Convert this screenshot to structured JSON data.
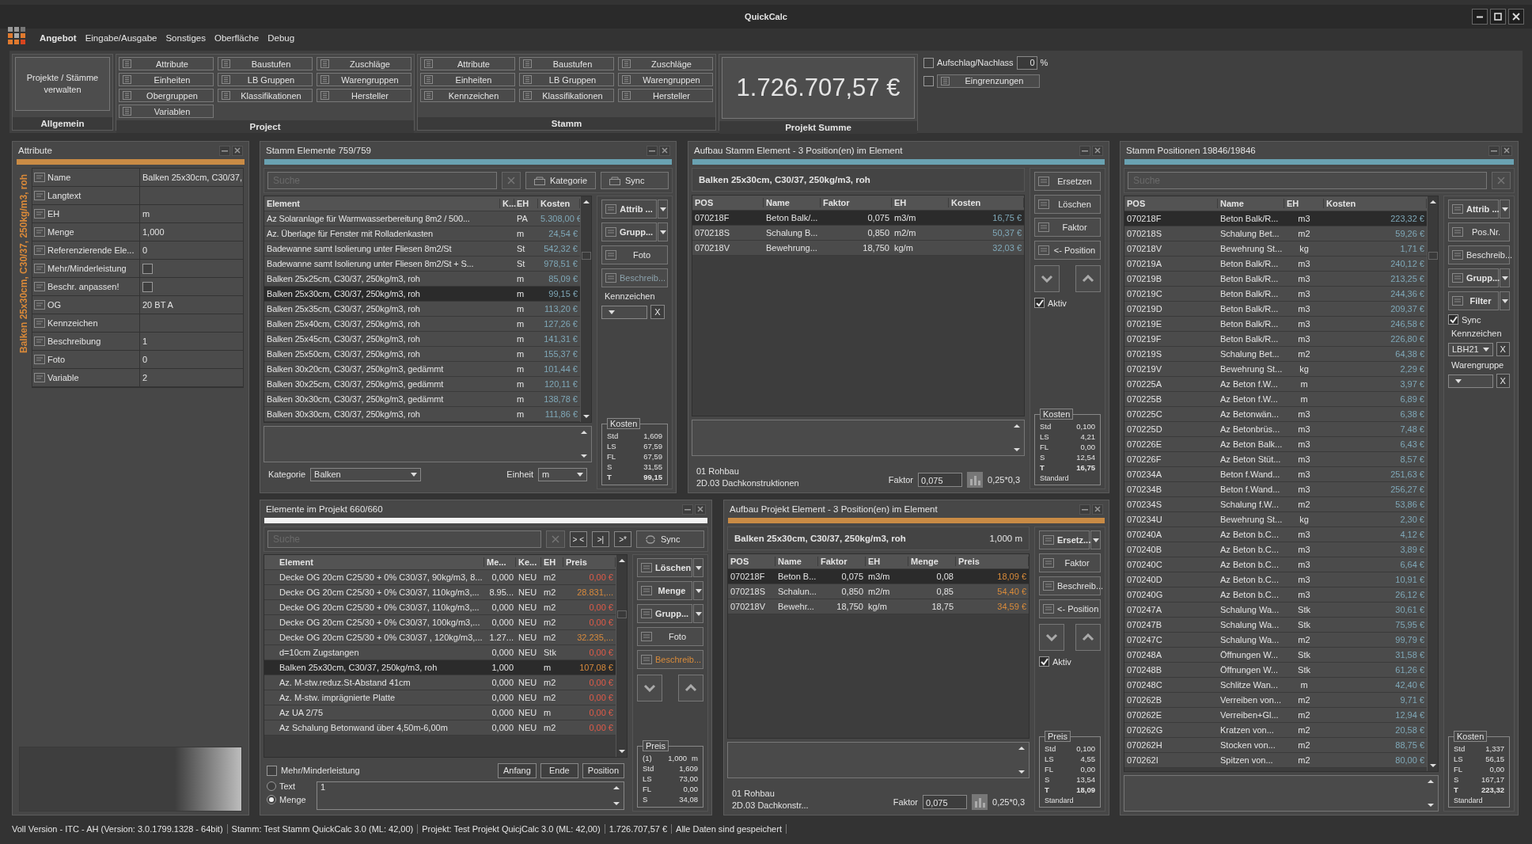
{
  "window": {
    "title": "QuickCalc"
  },
  "menu": [
    {
      "label": "Angebot",
      "selected": true
    },
    {
      "label": "Eingabe/Ausgabe",
      "selected": false
    },
    {
      "label": "Sonstiges",
      "selected": false
    },
    {
      "label": "Oberfläche",
      "selected": false
    },
    {
      "label": "Debug",
      "selected": false
    }
  ],
  "ribbon": {
    "allgemein": {
      "title": "Allgemein",
      "button": "Projekte / Stämme verwalten"
    },
    "project": {
      "title": "Project",
      "buttons": [
        "Attribute",
        "Baustufen",
        "Zuschläge",
        "Einheiten",
        "LB Gruppen",
        "Warengruppen",
        "Obergruppen",
        "Klassifikationen",
        "Hersteller",
        "Variablen"
      ]
    },
    "stamm": {
      "title": "Stamm",
      "buttons": [
        "Attribute",
        "Baustufen",
        "Zuschläge",
        "Einheiten",
        "LB Gruppen",
        "Warengruppen",
        "Kennzeichen",
        "Klassifikationen",
        "Hersteller"
      ]
    },
    "summe": {
      "title": "Projekt Summe",
      "value": "1.726.707,57 €"
    },
    "aufschlag": {
      "label": "Aufschlag/Nachlass",
      "checked": false,
      "value": "0",
      "unit": "%"
    },
    "eingrenzungen": {
      "label": "Eingrenzungen",
      "checked": false
    }
  },
  "attribute": {
    "title": "Attribute",
    "caption": "Balken 25x30cm, C30/37, 250kg/m3,  roh",
    "rows": [
      {
        "kind": "text",
        "label": "Name",
        "value": "Balken 25x30cm, C30/37,"
      },
      {
        "kind": "text",
        "label": "Langtext"
      },
      {
        "kind": "text",
        "label": "EH",
        "value": "m"
      },
      {
        "kind": "text",
        "label": "Menge",
        "value": "1,000"
      },
      {
        "kind": "text",
        "label": "Referenzierende Ele...",
        "value": "0"
      },
      {
        "kind": "check",
        "label": "Mehr/Minderleistung",
        "checked": false
      },
      {
        "kind": "check",
        "label": "Beschr. anpassen!",
        "checked": false
      },
      {
        "kind": "text",
        "label": "OG",
        "value": "20 BT A"
      },
      {
        "kind": "text",
        "label": "Kennzeichen"
      },
      {
        "kind": "text",
        "label": "Beschreibung",
        "value": "1"
      },
      {
        "kind": "text",
        "label": "Foto",
        "value": "0"
      },
      {
        "kind": "text",
        "label": "Variable",
        "value": "2"
      }
    ]
  },
  "stamm_elemente": {
    "title": "Stamm Elemente 759/759",
    "search": {
      "placeholder": "Suche"
    },
    "buttons": [
      "Kategorie",
      "Sync"
    ],
    "columns": [
      "Element",
      "K...",
      "EH",
      "Kosten"
    ],
    "rows": [
      {
        "element": "Az Solaranlage für Warmwasserbereitung 8m2 / 500...",
        "eh": "PA",
        "kosten": "5.308,00 €",
        "selected": false
      },
      {
        "element": "Az. Überlage für Fenster mit Rolladenkasten",
        "eh": "m",
        "kosten": "24,54 €",
        "selected": false
      },
      {
        "element": "Badewanne samt Isolierung unter Fliesen 8m2/St",
        "eh": "St",
        "kosten": "542,32 €",
        "selected": false
      },
      {
        "element": "Badewanne samt Isolierung unter Fliesen 8m2/St + S...",
        "eh": "St",
        "kosten": "978,51 €",
        "selected": false
      },
      {
        "element": "Balken 25x25cm, C30/37, 250kg/m3,  roh",
        "eh": "m",
        "kosten": "85,09 €",
        "selected": false
      },
      {
        "element": "Balken 25x30cm, C30/37, 250kg/m3,  roh",
        "eh": "m",
        "kosten": "99,15 €",
        "selected": true
      },
      {
        "element": "Balken 25x35cm, C30/37, 250kg/m3,  roh",
        "eh": "m",
        "kosten": "113,20 €",
        "selected": false
      },
      {
        "element": "Balken 25x40cm, C30/37, 250kg/m3,  roh",
        "eh": "m",
        "kosten": "127,26 €",
        "selected": false
      },
      {
        "element": "Balken 25x45cm, C30/37, 250kg/m3,  roh",
        "eh": "m",
        "kosten": "141,31 €",
        "selected": false
      },
      {
        "element": "Balken 25x50cm, C30/37, 250kg/m3,  roh",
        "eh": "m",
        "kosten": "155,37 €",
        "selected": false
      },
      {
        "element": "Balken 30x20cm, C30/37, 250kg/m3,  gedämmt",
        "eh": "m",
        "kosten": "101,44 €",
        "selected": false
      },
      {
        "element": "Balken 30x25cm, C30/37, 250kg/m3,  gedämmt",
        "eh": "m",
        "kosten": "120,11 €",
        "selected": false
      },
      {
        "element": "Balken 30x30cm, C30/37, 250kg/m3,  gedämmt",
        "eh": "m",
        "kosten": "138,78 €",
        "selected": false
      },
      {
        "element": "Balken 30x30cm, C30/37, 250kg/m3,  roh",
        "eh": "m",
        "kosten": "111,86 €",
        "selected": false
      }
    ],
    "side": [
      {
        "label": "Attrib ...",
        "split": true,
        "disabled": false
      },
      {
        "label": "Grupp...",
        "split": true,
        "disabled": false
      },
      {
        "label": "Foto",
        "split": false,
        "disabled": false
      },
      {
        "label": "Beschreib...",
        "split": false,
        "disabled": true
      }
    ],
    "kennzeichen": {
      "label": "Kennzeichen",
      "clear": "X"
    },
    "kosten": {
      "title": "Kosten",
      "rows": [
        {
          "label": "Std",
          "value": "1,609",
          "total": false
        },
        {
          "label": "LS",
          "value": "67,59",
          "total": false
        },
        {
          "label": "FL",
          "value": "67,59",
          "total": false
        },
        {
          "label": "S",
          "value": "31,55",
          "total": false
        },
        {
          "label": "T",
          "value": "99,15",
          "total": true
        }
      ]
    },
    "kategorie": {
      "label": "Kategorie",
      "value": "Balken"
    },
    "einheit": {
      "label": "Einheit",
      "value": "m"
    }
  },
  "aufbau_stamm": {
    "title": "Aufbau Stamm Element - 3 Position(en) im Element",
    "element": "Balken 25x30cm, C30/37, 250kg/m3,  roh",
    "columns": [
      "POS",
      "Name",
      "Faktor",
      "EH",
      "Kosten"
    ],
    "rows": [
      {
        "pos": "070218F",
        "name": "Beton Balk/...",
        "faktor": "0,075",
        "eh": "m3/m",
        "kosten": "16,75 €",
        "selected": true
      },
      {
        "pos": "070218S",
        "name": "Schalung B...",
        "faktor": "0,850",
        "eh": "m2/m",
        "kosten": "50,37 €",
        "selected": false
      },
      {
        "pos": "070218V",
        "name": "Bewehrung...",
        "faktor": "18,750",
        "eh": "kg/m",
        "kosten": "32,03 €",
        "selected": false
      }
    ],
    "side": [
      {
        "label": "Ersetzen",
        "split": false,
        "disabled": false
      },
      {
        "label": "Löschen",
        "split": false,
        "disabled": false
      },
      {
        "label": "Faktor",
        "split": false,
        "disabled": false
      },
      {
        "label": "<- Position",
        "split": false,
        "disabled": false
      }
    ],
    "aktiv": {
      "label": "Aktiv",
      "checked": true
    },
    "kosten": {
      "title": "Kosten",
      "footer": "Standard",
      "rows": [
        {
          "label": "Std",
          "value": "0,100",
          "total": false
        },
        {
          "label": "LS",
          "value": "4,21",
          "total": false
        },
        {
          "label": "FL",
          "value": "0,00",
          "total": false
        },
        {
          "label": "S",
          "value": "12,54",
          "total": false
        },
        {
          "label": "T",
          "value": "16,75",
          "total": true
        }
      ]
    },
    "gruppe": "01 Rohbau",
    "untergruppe": "2D.03 Dachkonstruktionen",
    "faktor": {
      "label": "Faktor",
      "value": "0,075",
      "formula": "0,25*0,3"
    }
  },
  "projekt_elemente": {
    "title": "Elemente im Projekt 660/660",
    "search": {
      "placeholder": "Suche"
    },
    "nav": [
      "> <",
      ">|",
      ">*"
    ],
    "sync": "Sync",
    "columns": [
      "Element",
      "Me...",
      "Ke...",
      "EH",
      "Preis"
    ],
    "rows": [
      {
        "element": "Decke OG 20cm C25/30 + 0% C30/37, 90kg/m3, 8...",
        "menge": "0,000",
        "ke": "NEU",
        "eh": "m2",
        "preis": "0,00 €",
        "color": "#e05a48",
        "selected": false
      },
      {
        "element": "Decke OG 20cm C25/30 + 0% C30/37, 110kg/m3,...",
        "menge": "8.95...",
        "ke": "NEU",
        "eh": "m2",
        "preis": "28.831,...",
        "color": "#d88a3c",
        "selected": false
      },
      {
        "element": "Decke OG 20cm C25/30 + 0% C30/37, 110kg/m3,...",
        "menge": "0,000",
        "ke": "NEU",
        "eh": "m2",
        "preis": "0,00 €",
        "color": "#e05a48",
        "selected": false
      },
      {
        "element": "Decke OG 20cm C25/30 + 0% C30/37, 100kg/m3,...",
        "menge": "0,000",
        "ke": "NEU",
        "eh": "m2",
        "preis": "0,00 €",
        "color": "#e05a48",
        "selected": false
      },
      {
        "element": "Decke OG 20cm C25/30 + 0% C30/37 , 120kg/m3,...",
        "menge": "1.27...",
        "ke": "NEU",
        "eh": "m2",
        "preis": "32.235,...",
        "color": "#d88a3c",
        "selected": false
      },
      {
        "element": "d=10cm Zugstangen",
        "menge": "0,000",
        "ke": "NEU",
        "eh": "Stk",
        "preis": "0,00 €",
        "color": "#e05a48",
        "selected": false
      },
      {
        "element": "Balken 25x30cm, C30/37, 250kg/m3,  roh",
        "menge": "1,000",
        "eh": "m",
        "preis": "107,08 €",
        "color": "#d88a3c",
        "selected": true
      },
      {
        "element": "Az. M-stw.reduz.St-Abstand 41cm",
        "menge": "0,000",
        "ke": "NEU",
        "eh": "m2",
        "preis": "0,00 €",
        "color": "#e05a48",
        "selected": false
      },
      {
        "element": "Az. M-stw. imprägnierte Platte",
        "menge": "0,000",
        "ke": "NEU",
        "eh": "m2",
        "preis": "0,00 €",
        "color": "#e05a48",
        "selected": false
      },
      {
        "element": "Az UA 2/75",
        "menge": "0,000",
        "ke": "NEU",
        "eh": "m",
        "preis": "0,00 €",
        "color": "#e05a48",
        "selected": false
      },
      {
        "element": "Az Schalung Betonwand über 4,50m-6,00m",
        "menge": "0,000",
        "ke": "NEU",
        "eh": "m2",
        "preis": "0,00 €",
        "color": "#e05a48",
        "selected": false
      }
    ],
    "side": [
      {
        "label": "Löschen",
        "split": true,
        "disabled": false
      },
      {
        "label": "Menge",
        "split": true,
        "disabled": false
      },
      {
        "label": "Grupp...",
        "split": true,
        "disabled": false
      },
      {
        "label": "Foto",
        "split": false,
        "disabled": false
      },
      {
        "label": "Beschreib...",
        "split": false,
        "disabled": true
      }
    ],
    "preis": {
      "title": "Preis",
      "count": "(1)",
      "menge": "1,000",
      "eh": "m",
      "rows": [
        {
          "label": "Std",
          "value": "1,609",
          "total": false
        },
        {
          "label": "LS",
          "value": "73,00",
          "total": false
        },
        {
          "label": "FL",
          "value": "0,00",
          "total": false
        },
        {
          "label": "S",
          "value": "34,08",
          "total": false
        }
      ]
    },
    "mehr": {
      "label": "Mehr/Minderleistung",
      "checked": false
    },
    "buttons": [
      "Anfang",
      "Ende",
      "Position"
    ],
    "modes": [
      {
        "label": "Text",
        "selected": false
      },
      {
        "label": "Menge",
        "selected": true
      }
    ],
    "value": "1"
  },
  "aufbau_projekt": {
    "title": "Aufbau Projekt Element - 3 Position(en) im Element",
    "element": "Balken 25x30cm, C30/37, 250kg/m3,  roh",
    "menge": "1,000 m",
    "columns": [
      "POS",
      "Name",
      "Faktor",
      "EH",
      "Menge",
      "Preis"
    ],
    "rows": [
      {
        "pos": "070218F",
        "name": "Beton B...",
        "faktor": "0,075",
        "eh": "m3/m",
        "menge": "0,08",
        "preis": "18,09 €",
        "selected": true
      },
      {
        "pos": "070218S",
        "name": "Schalun...",
        "faktor": "0,850",
        "eh": "m2/m",
        "menge": "0,85",
        "preis": "54,40 €",
        "selected": false
      },
      {
        "pos": "070218V",
        "name": "Bewehr...",
        "faktor": "18,750",
        "eh": "kg/m",
        "menge": "18,75",
        "preis": "34,59 €",
        "selected": false
      }
    ],
    "side": [
      {
        "label": "Ersetz...",
        "split": true,
        "disabled": false
      },
      {
        "label": "Faktor",
        "split": false,
        "disabled": false
      },
      {
        "label": "Beschreib...",
        "split": false,
        "disabled": false
      },
      {
        "label": "<- Position",
        "split": false,
        "disabled": false
      }
    ],
    "aktiv": {
      "label": "Aktiv",
      "checked": true
    },
    "preis": {
      "title": "Preis",
      "footer": "Standard",
      "rows": [
        {
          "label": "Std",
          "value": "0,100",
          "total": false
        },
        {
          "label": "LS",
          "value": "4,55",
          "total": false
        },
        {
          "label": "FL",
          "value": "0,00",
          "total": false
        },
        {
          "label": "S",
          "value": "13,54",
          "total": false
        },
        {
          "label": "T",
          "value": "18,09",
          "total": true
        }
      ]
    },
    "gruppe": "01 Rohbau",
    "untergruppe": "2D.03 Dachkonstr...",
    "faktor": {
      "label": "Faktor",
      "value": "0,075",
      "formula": "0,25*0,3"
    }
  },
  "stamm_positionen": {
    "title": "Stamm Positionen 19846/19846",
    "search": {
      "placeholder": "Suche"
    },
    "columns": [
      "POS",
      "Name",
      "EH",
      "Kosten"
    ],
    "rows": [
      {
        "pos": "070218F",
        "name": "Beton Balk/R...",
        "eh": "m3",
        "kosten": "223,32 €",
        "selected": true
      },
      {
        "pos": "070218S",
        "name": "Schalung Bet...",
        "eh": "m2",
        "kosten": "59,26 €",
        "selected": false
      },
      {
        "pos": "070218V",
        "name": "Bewehrung St...",
        "eh": "kg",
        "kosten": "1,71 €",
        "selected": false
      },
      {
        "pos": "070219A",
        "name": "Beton Balk/R...",
        "eh": "m3",
        "kosten": "240,12 €",
        "selected": false
      },
      {
        "pos": "070219B",
        "name": "Beton Balk/R...",
        "eh": "m3",
        "kosten": "213,25 €",
        "selected": false
      },
      {
        "pos": "070219C",
        "name": "Beton Balk/R...",
        "eh": "m3",
        "kosten": "244,36 €",
        "selected": false
      },
      {
        "pos": "070219D",
        "name": "Beton Balk/R...",
        "eh": "m3",
        "kosten": "209,37 €",
        "selected": false
      },
      {
        "pos": "070219E",
        "name": "Beton Balk/R...",
        "eh": "m3",
        "kosten": "246,58 €",
        "selected": false
      },
      {
        "pos": "070219F",
        "name": "Beton Balk/R...",
        "eh": "m3",
        "kosten": "226,80 €",
        "selected": false
      },
      {
        "pos": "070219S",
        "name": "Schalung Bet...",
        "eh": "m2",
        "kosten": "64,38 €",
        "selected": false
      },
      {
        "pos": "070219V",
        "name": "Bewehrung St...",
        "eh": "kg",
        "kosten": "2,29 €",
        "selected": false
      },
      {
        "pos": "070225A",
        "name": "Az Beton f.W...",
        "eh": "m",
        "kosten": "3,97 €",
        "selected": false
      },
      {
        "pos": "070225B",
        "name": "Az Beton f.W...",
        "eh": "m",
        "kosten": "6,89 €",
        "selected": false
      },
      {
        "pos": "070225C",
        "name": "Az Betonwän...",
        "eh": "m3",
        "kosten": "6,38 €",
        "selected": false
      },
      {
        "pos": "070225D",
        "name": "Az Betonbrüs...",
        "eh": "m3",
        "kosten": "7,48 €",
        "selected": false
      },
      {
        "pos": "070226E",
        "name": "Az Beton Balk...",
        "eh": "m3",
        "kosten": "6,43 €",
        "selected": false
      },
      {
        "pos": "070226F",
        "name": "Az Beton Stüt...",
        "eh": "m3",
        "kosten": "8,57 €",
        "selected": false
      },
      {
        "pos": "070234A",
        "name": "Beton f.Wand...",
        "eh": "m3",
        "kosten": "251,63 €",
        "selected": false
      },
      {
        "pos": "070234B",
        "name": "Beton f.Wand...",
        "eh": "m3",
        "kosten": "256,27 €",
        "selected": false
      },
      {
        "pos": "070234S",
        "name": "Schalung f.W...",
        "eh": "m2",
        "kosten": "53,86 €",
        "selected": false
      },
      {
        "pos": "070234U",
        "name": "Bewehrung St...",
        "eh": "kg",
        "kosten": "2,30 €",
        "selected": false
      },
      {
        "pos": "070240A",
        "name": "Az Beton b.C...",
        "eh": "m3",
        "kosten": "4,12 €",
        "selected": false
      },
      {
        "pos": "070240B",
        "name": "Az Beton b.C...",
        "eh": "m3",
        "kosten": "3,89 €",
        "selected": false
      },
      {
        "pos": "070240C",
        "name": "Az Beton b.C...",
        "eh": "m3",
        "kosten": "6,64 €",
        "selected": false
      },
      {
        "pos": "070240D",
        "name": "Az Beton b.C...",
        "eh": "m3",
        "kosten": "10,91 €",
        "selected": false
      },
      {
        "pos": "070240G",
        "name": "Az Beton b.C...",
        "eh": "m3",
        "kosten": "26,12 €",
        "selected": false
      },
      {
        "pos": "070247A",
        "name": "Schalung Wa...",
        "eh": "Stk",
        "kosten": "30,61 €",
        "selected": false
      },
      {
        "pos": "070247B",
        "name": "Schalung Wa...",
        "eh": "Stk",
        "kosten": "75,95 €",
        "selected": false
      },
      {
        "pos": "070247C",
        "name": "Schalung Wa...",
        "eh": "m2",
        "kosten": "99,79 €",
        "selected": false
      },
      {
        "pos": "070248A",
        "name": "Öffnungen W...",
        "eh": "Stk",
        "kosten": "31,58 €",
        "selected": false
      },
      {
        "pos": "070248B",
        "name": "Öffnungen W...",
        "eh": "Stk",
        "kosten": "61,26 €",
        "selected": false
      },
      {
        "pos": "070248C",
        "name": "Schlitze Wan...",
        "eh": "m",
        "kosten": "42,40 €",
        "selected": false
      },
      {
        "pos": "070262B",
        "name": "Verreiben von...",
        "eh": "m2",
        "kosten": "9,71 €",
        "selected": false
      },
      {
        "pos": "070262E",
        "name": "Verreiben+Gl...",
        "eh": "m2",
        "kosten": "12,94 €",
        "selected": false
      },
      {
        "pos": "070262G",
        "name": "Kratzen von...",
        "eh": "m2",
        "kosten": "20,58 €",
        "selected": false
      },
      {
        "pos": "070262H",
        "name": "Stocken von...",
        "eh": "m2",
        "kosten": "88,75 €",
        "selected": false
      },
      {
        "pos": "070262I",
        "name": "Spitzen von...",
        "eh": "m2",
        "kosten": "80,00 €",
        "selected": false
      }
    ],
    "side": [
      {
        "label": "Attrib ...",
        "split": true,
        "disabled": false
      },
      {
        "label": "Pos.Nr.",
        "split": false,
        "disabled": false
      },
      {
        "label": "Beschreib...",
        "split": false,
        "disabled": false
      },
      {
        "label": "Grupp...",
        "split": true,
        "disabled": false
      },
      {
        "label": "Filter",
        "split": true,
        "disabled": false
      }
    ],
    "sync": {
      "label": "Sync",
      "checked": true
    },
    "kennzeichen": {
      "label": "Kennzeichen",
      "value": "LBH21",
      "clear": "X"
    },
    "warengruppe": {
      "label": "Warengruppe",
      "clear": "X"
    },
    "kosten": {
      "title": "Kosten",
      "footer": "Standard",
      "rows": [
        {
          "label": "Std",
          "value": "1,337",
          "total": false
        },
        {
          "label": "LS",
          "value": "56,15",
          "total": false
        },
        {
          "label": "FL",
          "value": "0,00",
          "total": false
        },
        {
          "label": "S",
          "value": "167,17",
          "total": false
        },
        {
          "label": "T",
          "value": "223,32",
          "total": true
        }
      ]
    }
  },
  "status_bar": [
    "Voll Version - ITC - AH (Version: 3.0.1799.1328 - 64bit)",
    "Stamm: Test Stamm QuickCalc 3.0 (ML: 42,00)",
    "Projekt: Test Projekt QuicjCalc 3.0 (ML: 42,00)",
    "1.726.707,57 €",
    "Alle Daten sind gespeichert"
  ]
}
